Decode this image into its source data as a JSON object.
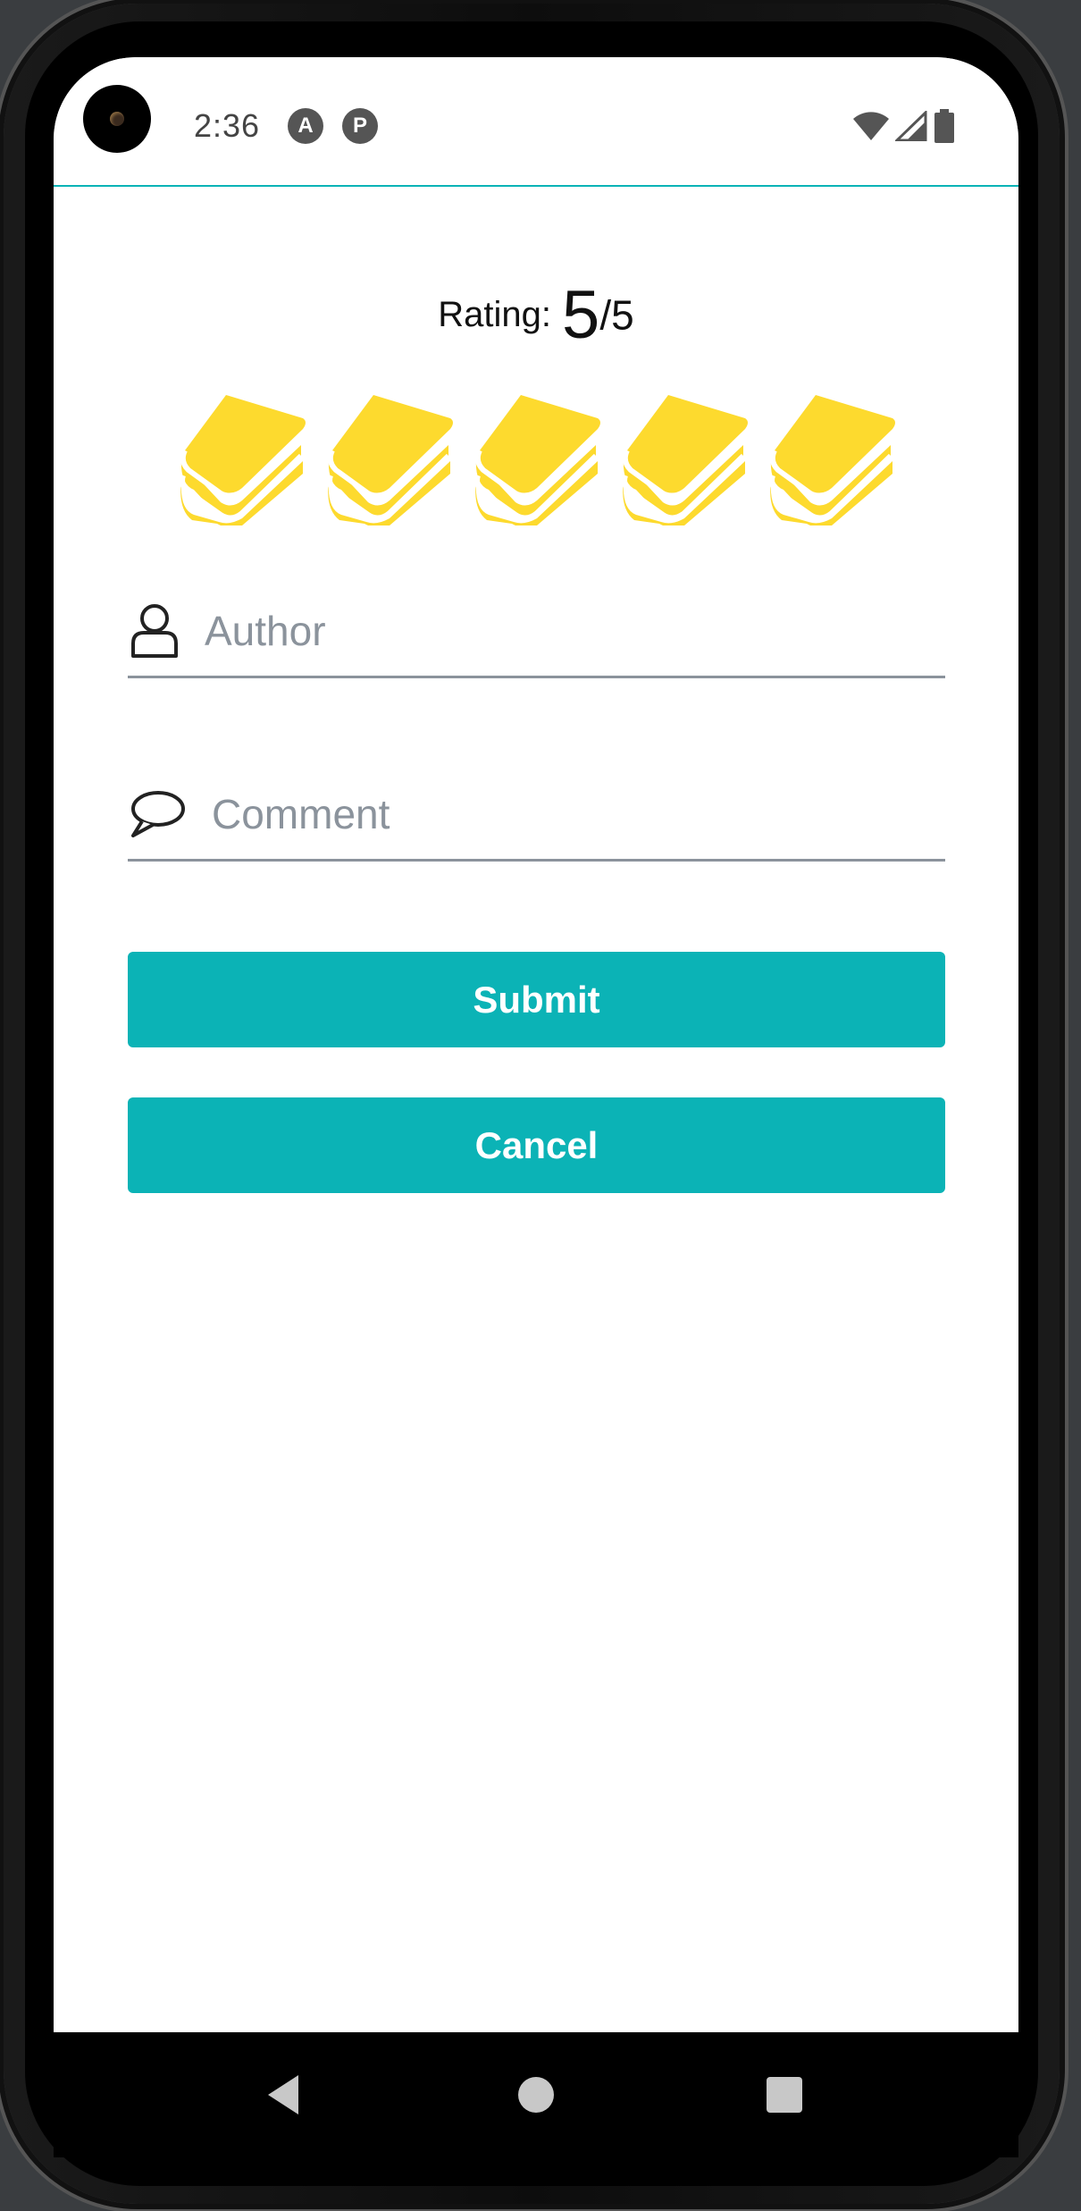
{
  "status_bar": {
    "time": "2:36",
    "app_icon_1": "A",
    "app_icon_2": "P",
    "icons": [
      "wifi-icon",
      "cell-signal-icon",
      "battery-icon"
    ]
  },
  "rating": {
    "label": "Rating:",
    "value": "5",
    "max": "/5",
    "books_filled": 5,
    "books_total": 5,
    "book_color": "#FDDA2E"
  },
  "form": {
    "author_placeholder": "Author",
    "author_value": "",
    "comment_placeholder": "Comment",
    "comment_value": ""
  },
  "buttons": {
    "submit_label": "Submit",
    "cancel_label": "Cancel"
  },
  "colors": {
    "accent": "#0BB3B6",
    "field_underline": "#8B939C"
  },
  "navigation": {
    "back": "back-icon",
    "home": "home-icon",
    "recents": "recents-icon"
  }
}
